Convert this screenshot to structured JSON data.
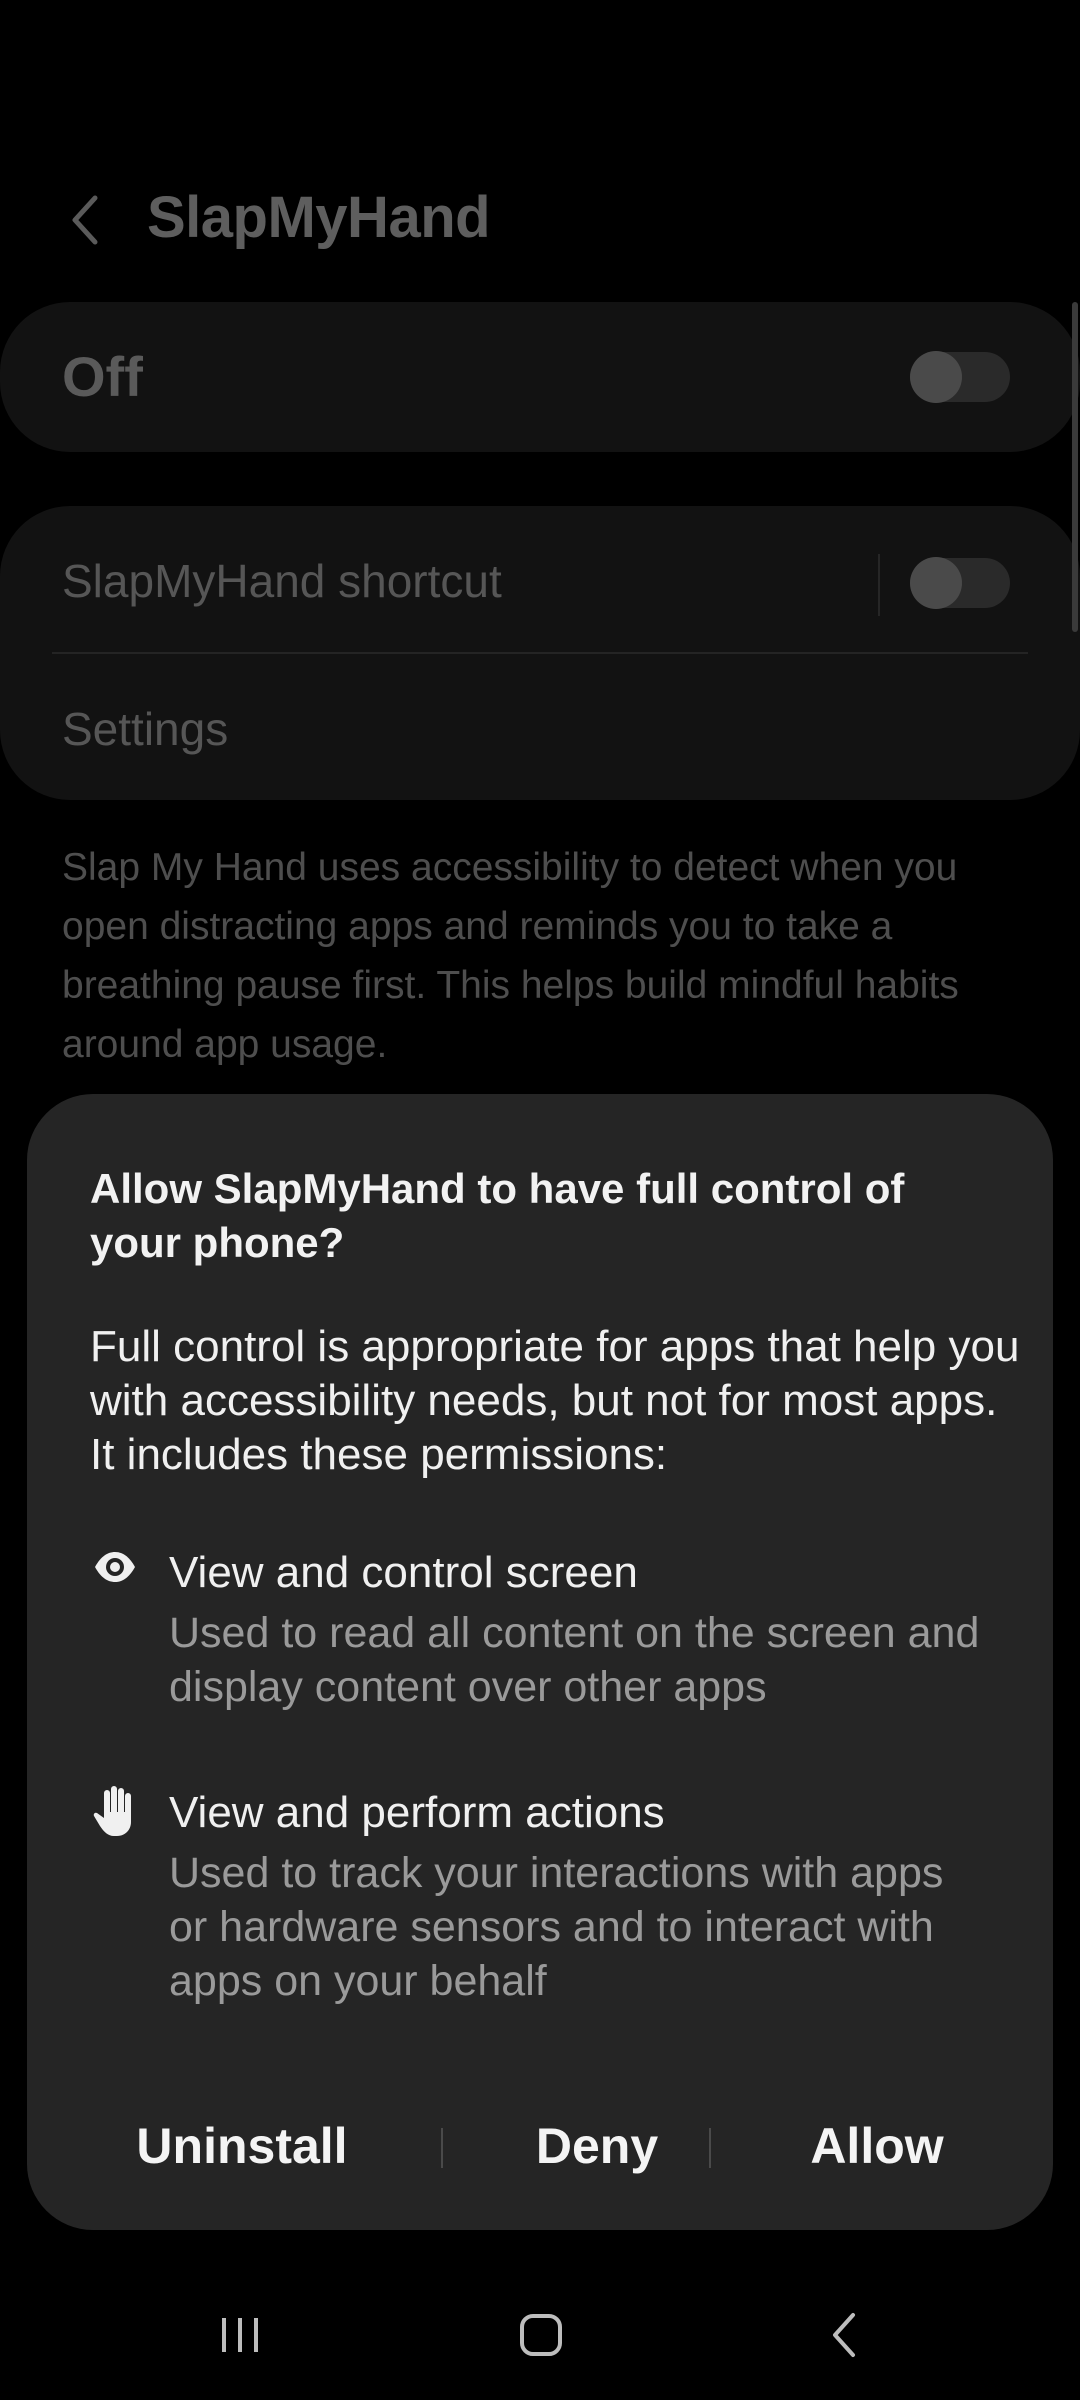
{
  "app_bar": {
    "title": "SlapMyHand",
    "back_icon": "chevron-left-icon"
  },
  "master_toggle": {
    "label": "Off",
    "state": false
  },
  "shortcut_row": {
    "label": "SlapMyHand shortcut",
    "state": false
  },
  "settings_row": {
    "label": "Settings"
  },
  "description": "Slap My Hand uses accessibility to detect when you open distracting apps and reminds you to take a breathing pause first. This helps build mindful habits around app usage.",
  "dialog": {
    "title": "Allow SlapMyHand to have full control of your phone?",
    "body": "Full control is appropriate for apps that help you with accessibility needs, but not for most apps. It includes these permissions:",
    "permissions": [
      {
        "icon": "eye-icon",
        "title": "View and control screen",
        "description": "Used to read all content on the screen and display content over other apps"
      },
      {
        "icon": "hand-icon",
        "title": "View and perform actions",
        "description": "Used to track your interactions with apps or hardware sensors and to interact with apps on your behalf"
      }
    ],
    "actions": {
      "uninstall": "Uninstall",
      "deny": "Deny",
      "allow": "Allow"
    }
  },
  "nav_bar": {
    "recent_icon": "recent-apps-icon",
    "home_icon": "home-icon",
    "back_icon": "back-icon"
  },
  "colors": {
    "background": "#000000",
    "card": "#121212",
    "dialog": "#252525",
    "primary_text": "#f0f0f0",
    "secondary_text": "#9a9a9a"
  }
}
